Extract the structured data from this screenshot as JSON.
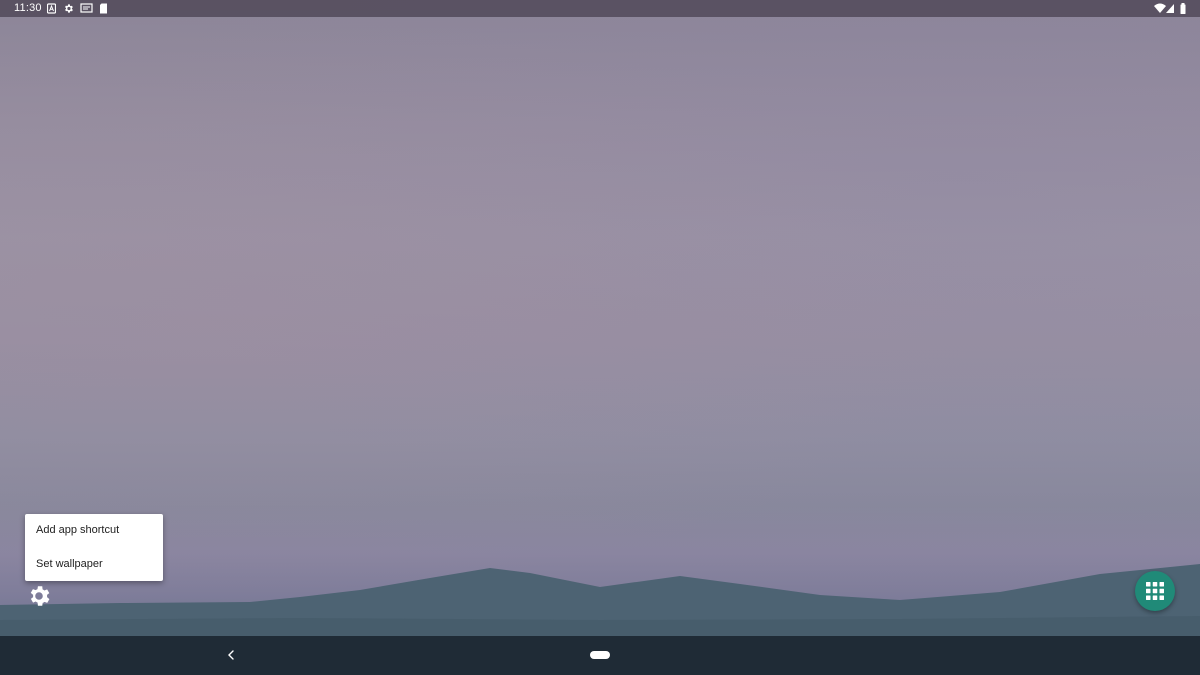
{
  "status_bar": {
    "time": "11:30",
    "left_icons": [
      "a-box-icon",
      "gear-icon",
      "cast-icon",
      "sd-card-icon"
    ],
    "right_icons": [
      "wifi-icon",
      "signal-icon",
      "battery-icon"
    ]
  },
  "context_menu": {
    "items": [
      {
        "label": "Add app shortcut"
      },
      {
        "label": "Set wallpaper"
      }
    ]
  },
  "desktop": {
    "settings_icon": "gear-icon",
    "app_drawer_icon": "grid-icon",
    "app_drawer_color": "#208a78"
  },
  "nav_bar": {
    "back_icon": "back-chevron-icon",
    "home_icon": "home-pill-icon"
  }
}
